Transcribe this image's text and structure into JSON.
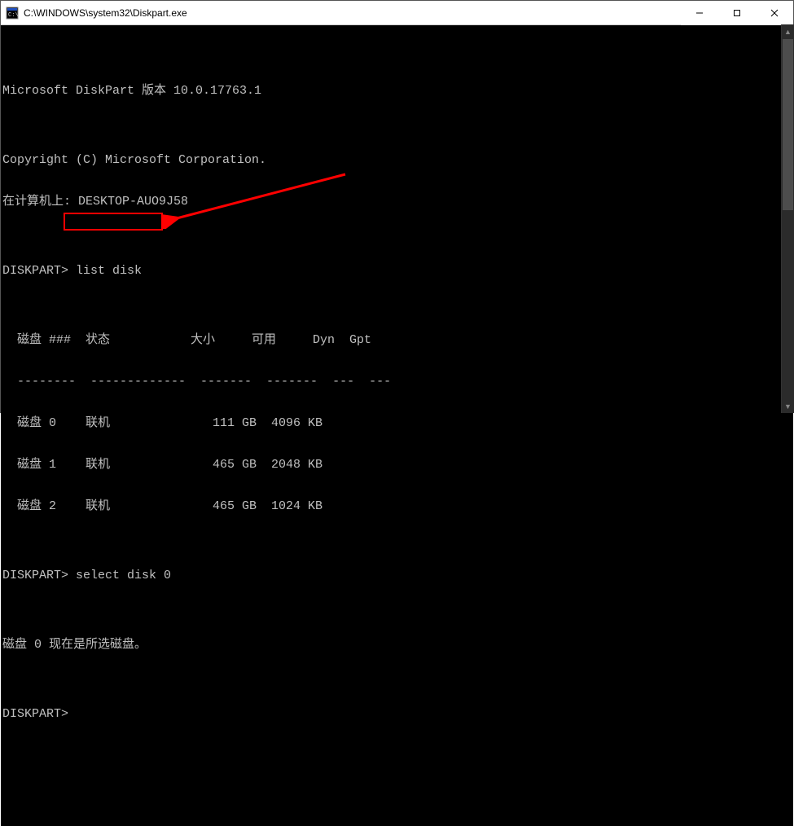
{
  "window": {
    "title": "C:\\WINDOWS\\system32\\Diskpart.exe"
  },
  "lines": {
    "blank": "",
    "version": "Microsoft DiskPart 版本 10.0.17763.1",
    "copyright": "Copyright (C) Microsoft Corporation.",
    "computer": "在计算机上: DESKTOP-AUO9J58",
    "prompt1_prefix": "DISKPART> ",
    "prompt1_cmd": "list disk",
    "header": "  磁盘 ###  状态           大小     可用     Dyn  Gpt",
    "divider": "  --------  -------------  -------  -------  ---  ---",
    "row0": "  磁盘 0    联机              111 GB  4096 KB",
    "row1": "  磁盘 1    联机              465 GB  2048 KB",
    "row2": "  磁盘 2    联机              465 GB  1024 KB",
    "prompt2_prefix": "DISKPART> ",
    "prompt2_cmd": "select disk 0",
    "selected": "磁盘 0 现在是所选磁盘。",
    "prompt3": "DISKPART>"
  },
  "table": {
    "columns": [
      "磁盘 ###",
      "状态",
      "大小",
      "可用",
      "Dyn",
      "Gpt"
    ],
    "rows": [
      {
        "disk": "磁盘 0",
        "status": "联机",
        "size": "111 GB",
        "free": "4096 KB",
        "dyn": "",
        "gpt": ""
      },
      {
        "disk": "磁盘 1",
        "status": "联机",
        "size": "465 GB",
        "free": "2048 KB",
        "dyn": "",
        "gpt": ""
      },
      {
        "disk": "磁盘 2",
        "status": "联机",
        "size": "465 GB",
        "free": "1024 KB",
        "dyn": "",
        "gpt": ""
      }
    ]
  },
  "annotation": {
    "highlight_color": "#ff0000",
    "arrow_color": "#ff0000"
  }
}
